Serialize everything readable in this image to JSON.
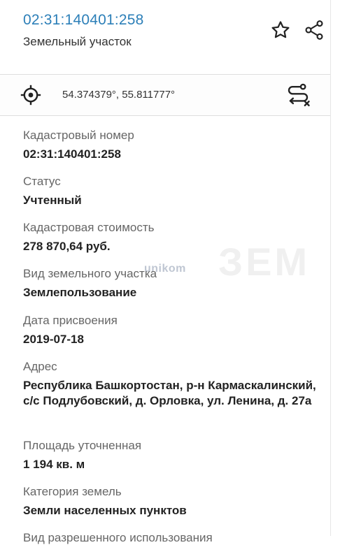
{
  "header": {
    "cadastral_link": "02:31:140401:258",
    "subtitle": "Земельный участок"
  },
  "icons": {
    "favorite": "star-icon",
    "share": "share-icon",
    "location": "crosshair-icon",
    "route": "route-icon"
  },
  "coordinates": {
    "text": "54.374379°, 55.811777°"
  },
  "fields": [
    {
      "label": "Кадастровый номер",
      "value": "02:31:140401:258"
    },
    {
      "label": "Статус",
      "value": "Учтенный"
    },
    {
      "label": "Кадастровая стоимость",
      "value": "278 870,64 руб."
    },
    {
      "label": "Вид земельного участка",
      "value": "Землепользование"
    },
    {
      "label": "Дата присвоения",
      "value": "2019-07-18"
    },
    {
      "label": "Адрес",
      "value": "Республика Башкортостан, р-н Кармаскалинский, с/с Подлубовский, д. Орловка, ул. Ленина, д. 27а"
    },
    {
      "label": "Площадь уточненная",
      "value": "1 194 кв. м"
    },
    {
      "label": "Категория земель",
      "value": "Земли населенных пунктов"
    },
    {
      "label": "Вид разрешенного использования",
      "value": ""
    }
  ],
  "watermark": "unikom",
  "colors": {
    "link": "#2c7fb8",
    "label": "#666666",
    "value": "#222222",
    "divider": "#dedede"
  }
}
